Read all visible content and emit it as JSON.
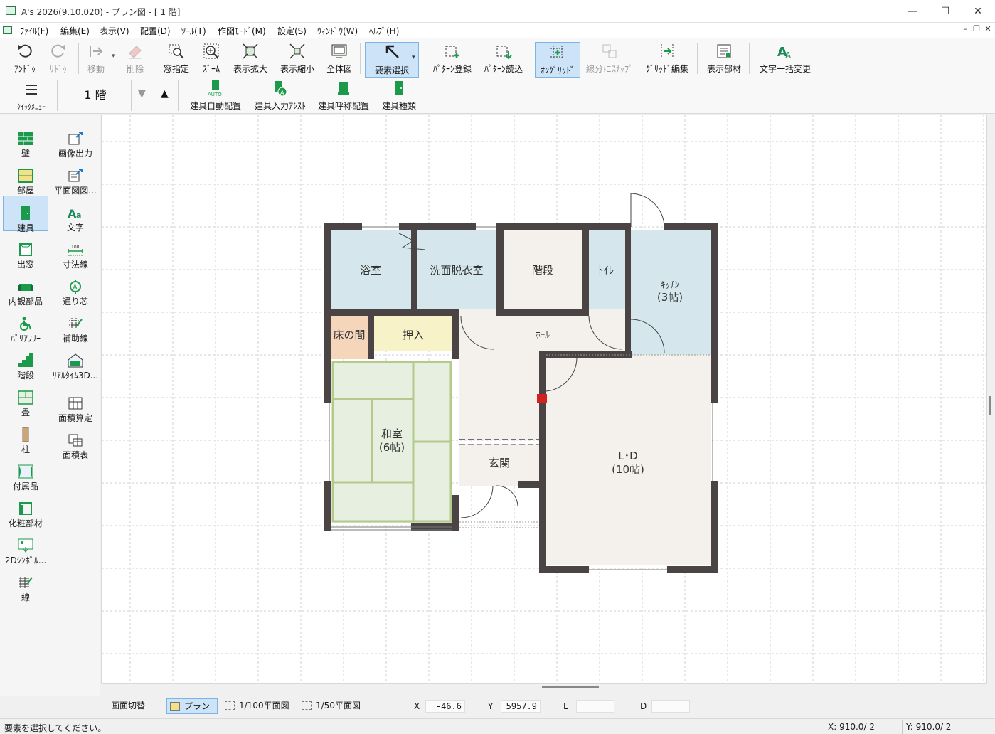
{
  "window": {
    "title": "A's 2026(9.10.020) - プラン図 - [ 1 階]",
    "minimize": "—",
    "maximize": "☐",
    "close": "✕"
  },
  "menu": [
    "ﾌｧｲﾙ(F)",
    "編集(E)",
    "表示(V)",
    "配置(D)",
    "ﾂｰﾙ(T)",
    "作図ﾓｰﾄﾞ(M)",
    "設定(S)",
    "ｳｨﾝﾄﾞｳ(W)",
    "ﾍﾙﾌﾟ(H)"
  ],
  "toolbar1": {
    "undo": "ｱﾝﾄﾞｩ",
    "redo": "ﾘﾄﾞｩ",
    "move": "移動",
    "delete": "削除",
    "window_zoom": "窓指定",
    "zoom": "ｽﾞｰﾑ",
    "zoom_in": "表示拡大",
    "zoom_out": "表示縮小",
    "fit_all": "全体図",
    "select": "要素選択",
    "pattern_save": "ﾊﾟﾀｰﾝ登録",
    "pattern_load": "ﾊﾟﾀｰﾝ読込",
    "on_grid": "ｵﾝｸﾞﾘｯﾄﾞ",
    "snap_division": "線分にｽﾅｯﾌﾟ",
    "grid_edit": "ｸﾞﾘｯﾄﾞ編集",
    "display_parts": "表示部材",
    "text_replace": "文字一括変更"
  },
  "toolbar2": {
    "quick_menu": "ｸｲｯｸﾒﾆｭｰ",
    "floor": "1 階",
    "auto_place": "建具自動配置",
    "input_assist": "建具入力ｱｼｽﾄ",
    "call_place": "建具呼称配置",
    "fitting_type": "建具種類"
  },
  "palette": {
    "left": [
      "壁",
      "部屋",
      "建具",
      "出窓",
      "内観部品",
      "ﾊﾞﾘｱﾌﾘｰ",
      "階段",
      "畳",
      "柱",
      "付属品",
      "化粧部材",
      "2Dｼﾝﾎﾞﾙ...",
      "線"
    ],
    "right": [
      "画像出力",
      "平面図図...",
      "文字",
      "寸法線",
      "通り芯",
      "補助線",
      "ﾘｱﾙﾀｲﾑ3D...",
      "面積算定",
      "面積表"
    ],
    "active": "建具"
  },
  "plan": {
    "rooms": {
      "bath": "浴室",
      "wash": "洗面脱衣室",
      "stairs": "階段",
      "toilet": "ﾄｲﾚ",
      "kitchen": "ｷｯﾁﾝ",
      "kitchen_size": "(3帖)",
      "alcove": "床の間",
      "closet": "押入",
      "hall": "ﾎｰﾙ",
      "washitsu": "和室",
      "washitsu_size": "(6帖)",
      "entrance": "玄関",
      "ld": "L･D",
      "ld_size": "(10帖)"
    }
  },
  "bottombar": {
    "screen_switch": "画面切替",
    "plan_tab": "プラン",
    "scale100": "1/100平面図",
    "scale50": "1/50平面図",
    "x_label": "X",
    "x_value": "-46.6",
    "y_label": "Y",
    "y_value": "5957.9",
    "l_label": "L",
    "l_value": "",
    "d_label": "D",
    "d_value": ""
  },
  "status": {
    "message": "要素を選択してください。",
    "x": "X: 910.0/ 2",
    "y": "Y: 910.0/ 2"
  },
  "colors": {
    "accent": "#cde3f7",
    "accent_border": "#7db4e6",
    "wall": "#4a4444",
    "wet_room": "#d5e7ec",
    "floor_beige": "#f4f1ec",
    "tatami": "#e7efe0",
    "closet": "#f7f2c8",
    "alcove": "#f5d6bb"
  }
}
